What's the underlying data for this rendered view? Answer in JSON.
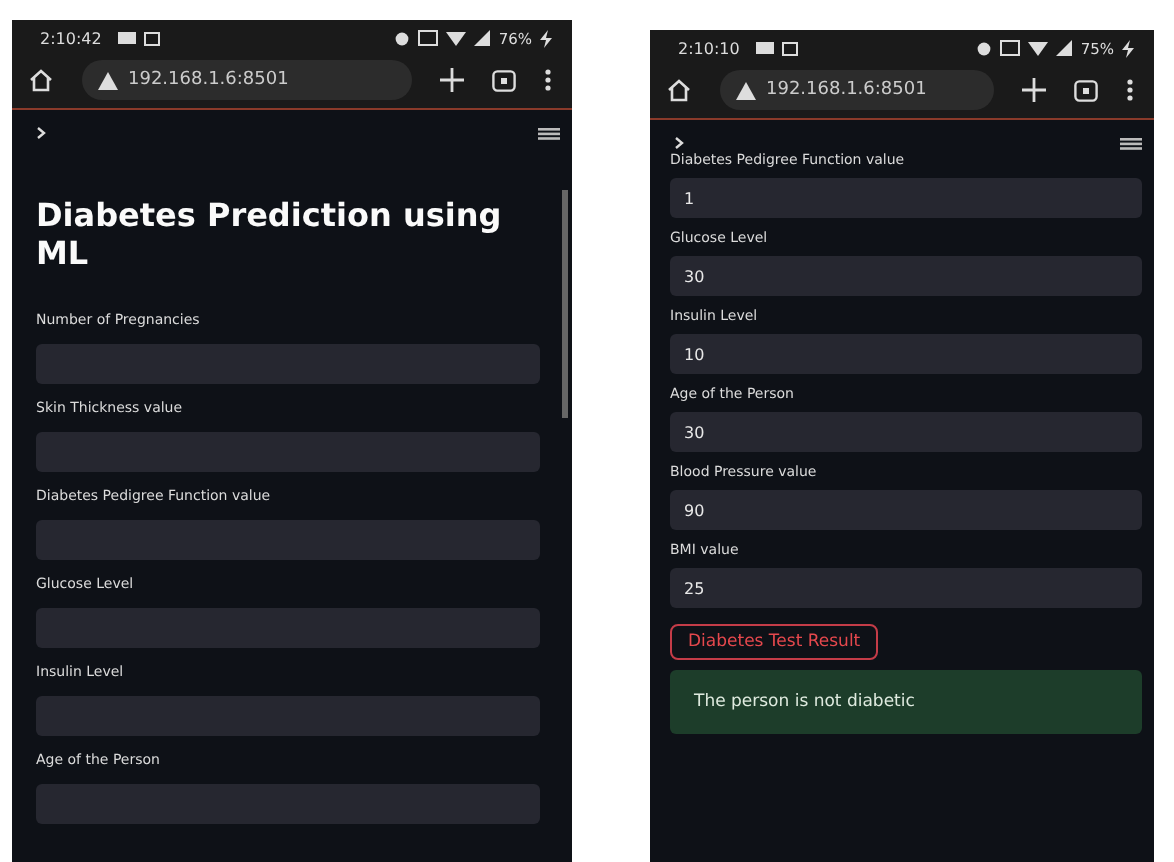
{
  "phones": [
    {
      "status_bar": {
        "time": "2:10:42",
        "battery": "76%"
      },
      "address_bar": {
        "url": "192.168.1.6:8501"
      },
      "title": "Diabetes Prediction using ML",
      "show_scrollbar": true,
      "fields": [
        {
          "label": "Number of Pregnancies"
        },
        {
          "label": "Skin Thickness value"
        },
        {
          "label": "Diabetes Pedigree Function value"
        },
        {
          "label": "Glucose Level"
        },
        {
          "label": "Insulin Level"
        },
        {
          "label": "Age of the Person"
        }
      ]
    },
    {
      "status_bar": {
        "time": "2:10:10",
        "battery": "75%"
      },
      "address_bar": {
        "url": "192.168.1.6:8501"
      },
      "show_scrollbar": false,
      "fields": [
        {
          "label": "Diabetes Pedigree Function value",
          "value": "1"
        },
        {
          "label": "Glucose Level",
          "value": "30"
        },
        {
          "label": "Insulin Level",
          "value": "10"
        },
        {
          "label": "Age of the Person",
          "value": "30"
        },
        {
          "label": "Blood Pressure value",
          "value": "90"
        },
        {
          "label": "BMI value",
          "value": "25"
        }
      ],
      "button": "Diabetes Test Result",
      "result": "The person is not diabetic"
    }
  ]
}
